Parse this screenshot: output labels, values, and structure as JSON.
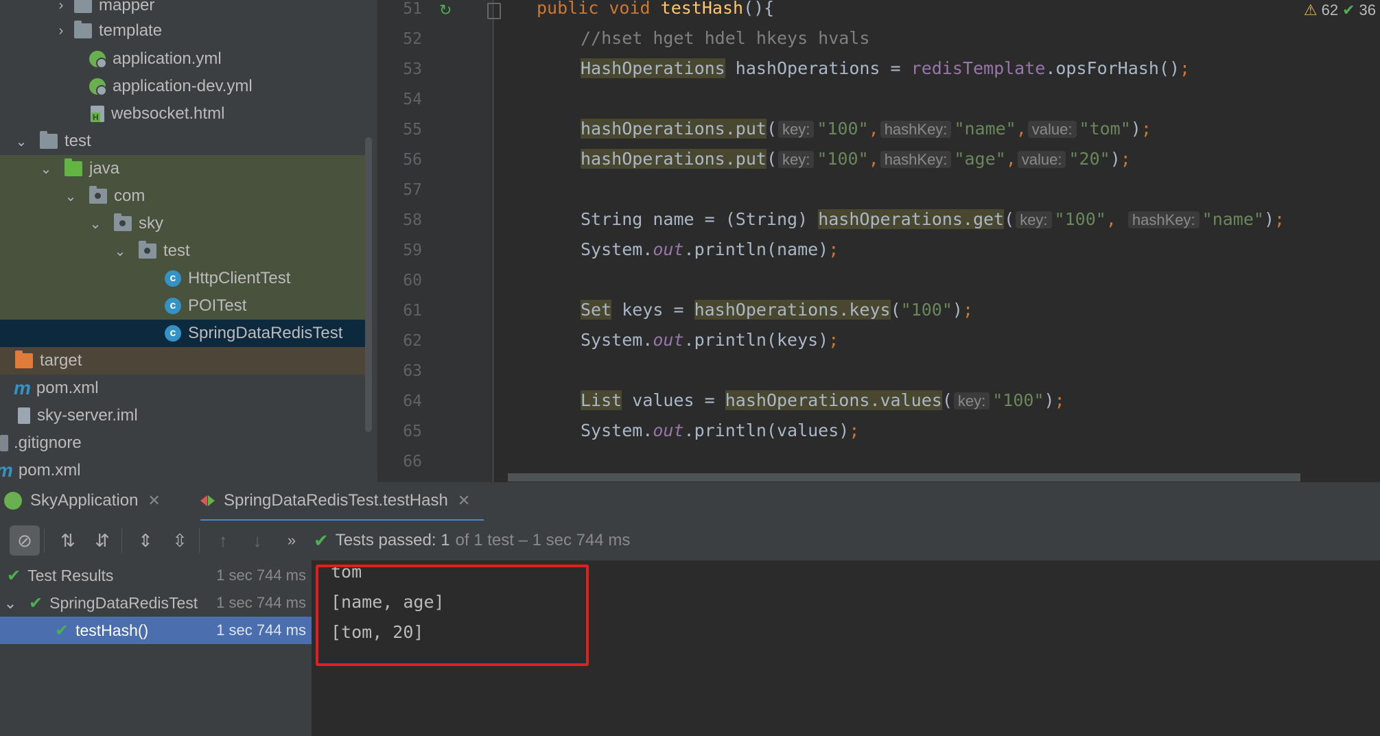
{
  "project_tree": {
    "items": [
      {
        "label": "mapper"
      },
      {
        "label": "template"
      },
      {
        "label": "application.yml"
      },
      {
        "label": "application-dev.yml"
      },
      {
        "label": "websocket.html"
      },
      {
        "label": "test"
      },
      {
        "label": "java"
      },
      {
        "label": "com"
      },
      {
        "label": "sky"
      },
      {
        "label": "test"
      },
      {
        "label": "HttpClientTest"
      },
      {
        "label": "POITest"
      },
      {
        "label": "SpringDataRedisTest"
      },
      {
        "label": "target"
      },
      {
        "label": "pom.xml"
      },
      {
        "label": "sky-server.iml"
      },
      {
        "label": ".gitignore"
      },
      {
        "label": "pom.xml"
      }
    ]
  },
  "editor": {
    "line_numbers": [
      "51",
      "52",
      "53",
      "54",
      "55",
      "56",
      "57",
      "58",
      "59",
      "60",
      "61",
      "62",
      "63",
      "64",
      "65",
      "66"
    ],
    "inspections": {
      "warnings": "62",
      "ok": "36"
    },
    "l51": {
      "kw1": "public",
      "kw2": "void",
      "fn": "testHash",
      "rest": "(){"
    },
    "l52": {
      "comment": "//hset hget hdel hkeys hvals"
    },
    "l53": {
      "type": "HashOperations",
      "mid": " hashOperations = ",
      "field": "redisTemplate",
      "rest": ".opsForHash()",
      "semi": ";"
    },
    "l55": {
      "call": "hashOperations.put",
      "p": "(",
      "h1": "key:",
      "s1": "\"100\"",
      "c1": ",",
      "h2": "hashKey:",
      "s2": "\"name\"",
      "c2": ",",
      "h3": "value:",
      "s3": "\"tom\"",
      "end": ")",
      "semi": ";"
    },
    "l56": {
      "call": "hashOperations.put",
      "p": "(",
      "h1": "key:",
      "s1": "\"100\"",
      "c1": ",",
      "h2": "hashKey:",
      "s2": "\"age\"",
      "c2": ",",
      "h3": "value:",
      "s3": "\"20\"",
      "end": ")",
      "semi": ";"
    },
    "l58": {
      "pre": "String name = (String) ",
      "call": "hashOperations.get",
      "p": "(",
      "h1": "key:",
      "s1": "\"100\"",
      "c1": ", ",
      "h2": "hashKey:",
      "s2": "\"name\"",
      "end": ")",
      "semi": ";"
    },
    "l59": {
      "pre": "System.",
      "stat": "out",
      "rest": ".println(name)",
      "semi": ";"
    },
    "l61": {
      "type": "Set",
      "mid": " keys = ",
      "call": "hashOperations.keys",
      "p": "(",
      "s1": "\"100\"",
      "end": ")",
      "semi": ";"
    },
    "l62": {
      "pre": "System.",
      "stat": "out",
      "rest": ".println(keys)",
      "semi": ";"
    },
    "l64": {
      "type": "List",
      "mid": " values = ",
      "call": "hashOperations.values",
      "p": "(",
      "h1": "key:",
      "s1": "\"100\"",
      "end": ")",
      "semi": ";"
    },
    "l65": {
      "pre": "System.",
      "stat": "out",
      "rest": ".println(values)",
      "semi": ";"
    }
  },
  "run": {
    "tabs": [
      {
        "label": "SkyApplication"
      },
      {
        "label": "SpringDataRedisTest.testHash"
      }
    ],
    "status": {
      "main": "Tests passed: 1",
      "rest": "of 1 test – 1 sec 744 ms"
    },
    "results": [
      {
        "label": "Test Results",
        "time": "1 sec 744 ms"
      },
      {
        "label": "SpringDataRedisTest",
        "time": "1 sec 744 ms"
      },
      {
        "label": "testHash()",
        "time": "1 sec 744 ms"
      }
    ],
    "console": [
      "tom",
      "[name, age]",
      "[tom, 20]"
    ]
  },
  "colors": {
    "highlight_box": "#e02020",
    "pass_green": "#4caf50",
    "selection_blue": "#4b6eaf"
  }
}
